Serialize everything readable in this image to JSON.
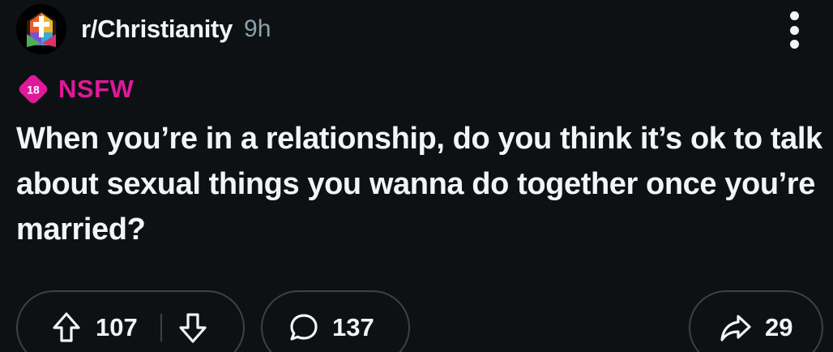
{
  "header": {
    "subreddit": "r/Christianity",
    "time": "9h",
    "avatar_icon": "stained-glass-cross-icon"
  },
  "tag": {
    "badge_text": "18",
    "label": "NSFW",
    "color": "#e0189a"
  },
  "post": {
    "title": "When you’re in a relationship, do you think it’s ok to talk about sexual things you wanna do together once you’re married?"
  },
  "actions": {
    "upvotes": "107",
    "comments": "137",
    "shares": "29"
  },
  "colors": {
    "background": "#0e1113",
    "text": "#f2f4f5",
    "muted": "#8ba2ad",
    "border": "#3a4246"
  }
}
